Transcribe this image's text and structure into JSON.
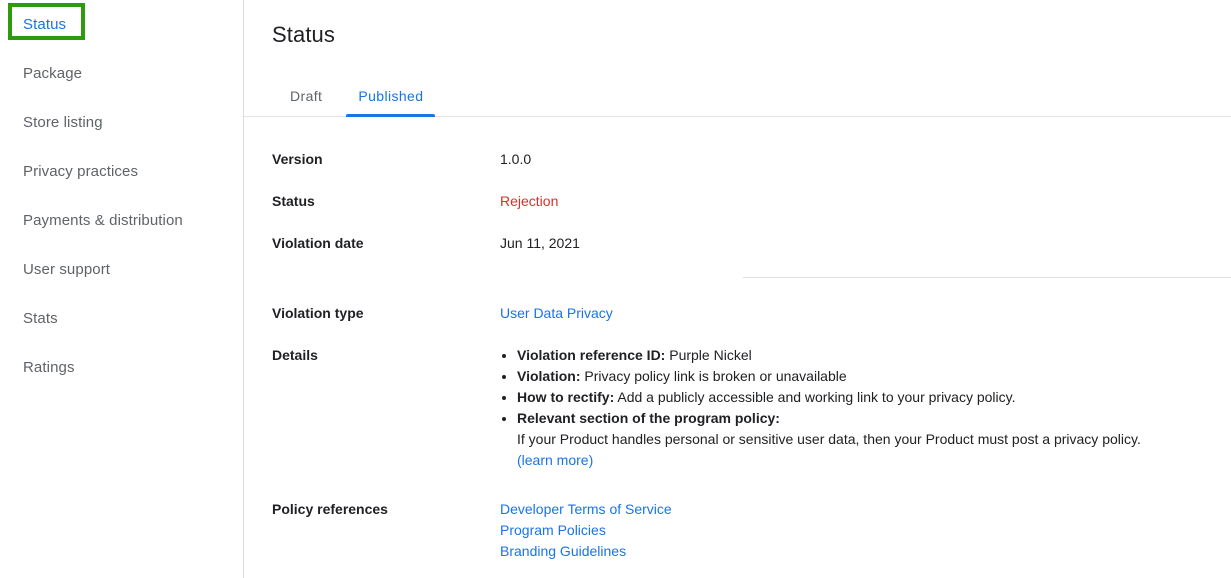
{
  "sidebar": {
    "items": [
      {
        "label": "Status",
        "active": true
      },
      {
        "label": "Package",
        "active": false
      },
      {
        "label": "Store listing",
        "active": false
      },
      {
        "label": "Privacy practices",
        "active": false
      },
      {
        "label": "Payments & distribution",
        "active": false
      },
      {
        "label": "User support",
        "active": false
      },
      {
        "label": "Stats",
        "active": false
      },
      {
        "label": "Ratings",
        "active": false
      }
    ],
    "highlight_color": "#2e9b0f",
    "active_color": "#1a73e8"
  },
  "main": {
    "title": "Status",
    "tabs": [
      {
        "label": "Draft",
        "active": false
      },
      {
        "label": "Published",
        "active": true
      }
    ],
    "fields": {
      "version_label": "Version",
      "version_value": "1.0.0",
      "status_label": "Status",
      "status_value": "Rejection",
      "status_value_color": "#d93025",
      "violation_date_label": "Violation date",
      "violation_date_value": "Jun 11, 2021",
      "violation_type_label": "Violation type",
      "violation_type_value": "User Data Privacy",
      "details_label": "Details",
      "policy_references_label": "Policy references"
    },
    "details_bullets": [
      {
        "term": "Violation reference ID:",
        "text": " Purple Nickel"
      },
      {
        "term": "Violation:",
        "text": " Privacy policy link is broken or unavailable"
      },
      {
        "term": "How to rectify:",
        "text": " Add a publicly accessible and working link to your privacy policy."
      },
      {
        "term": "Relevant section of the program policy:",
        "text": ""
      }
    ],
    "program_policy_text": "If your Product handles personal or sensitive user data, then your Product must post a privacy policy.",
    "learn_more_label": "(learn more)",
    "policy_references": [
      "Developer Terms of Service",
      "Program Policies",
      "Branding Guidelines"
    ]
  }
}
